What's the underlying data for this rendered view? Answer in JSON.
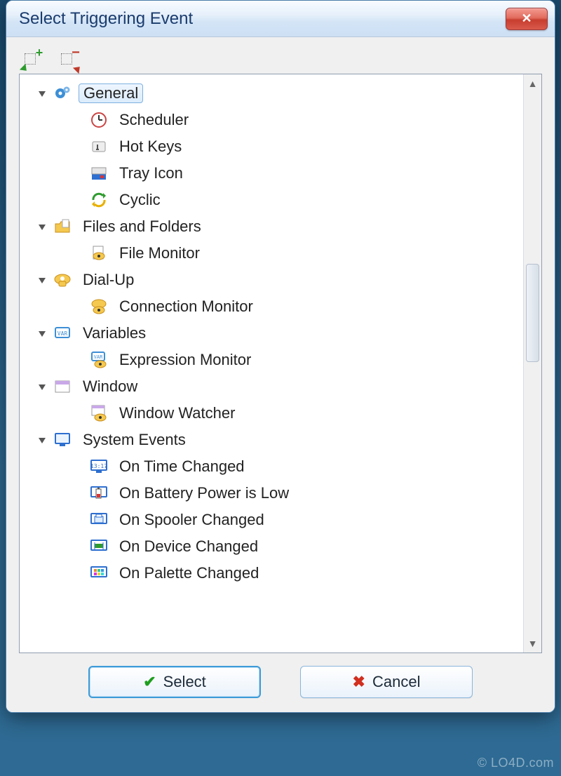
{
  "window": {
    "title": "Select Triggering Event"
  },
  "toolbar": {
    "expand_all": "expand-all",
    "collapse_all": "collapse-all"
  },
  "tree": {
    "selected": "General",
    "groups": [
      {
        "id": "general",
        "label": "General",
        "icon": "gears-icon",
        "expanded": true,
        "selected": true,
        "children": [
          {
            "id": "scheduler",
            "label": "Scheduler",
            "icon": "clock-icon"
          },
          {
            "id": "hotkeys",
            "label": "Hot Keys",
            "icon": "key-icon"
          },
          {
            "id": "trayicon",
            "label": "Tray Icon",
            "icon": "tray-icon"
          },
          {
            "id": "cyclic",
            "label": "Cyclic",
            "icon": "cycle-icon"
          }
        ]
      },
      {
        "id": "files",
        "label": "Files and Folders",
        "icon": "folder-icon",
        "expanded": true,
        "children": [
          {
            "id": "filemon",
            "label": "File Monitor",
            "icon": "eye-file-icon"
          }
        ]
      },
      {
        "id": "dialup",
        "label": "Dial-Up",
        "icon": "phone-icon",
        "expanded": true,
        "children": [
          {
            "id": "connmon",
            "label": "Connection Monitor",
            "icon": "eye-phone-icon"
          }
        ]
      },
      {
        "id": "variables",
        "label": "Variables",
        "icon": "var-icon",
        "expanded": true,
        "children": [
          {
            "id": "exprmon",
            "label": "Expression Monitor",
            "icon": "eye-var-icon"
          }
        ]
      },
      {
        "id": "window",
        "label": "Window",
        "icon": "window-icon",
        "expanded": true,
        "children": [
          {
            "id": "winwatch",
            "label": "Window Watcher",
            "icon": "eye-window-icon"
          }
        ]
      },
      {
        "id": "sysevents",
        "label": "System Events",
        "icon": "monitor-icon",
        "expanded": true,
        "children": [
          {
            "id": "timechg",
            "label": "On Time Changed",
            "icon": "digital-clock-icon"
          },
          {
            "id": "battlow",
            "label": "On Battery Power is Low",
            "icon": "battery-icon"
          },
          {
            "id": "spooler",
            "label": "On Spooler Changed",
            "icon": "printer-icon"
          },
          {
            "id": "device",
            "label": "On Device Changed",
            "icon": "chip-icon"
          },
          {
            "id": "palette",
            "label": "On Palette Changed",
            "icon": "palette-icon"
          }
        ]
      }
    ]
  },
  "buttons": {
    "select": "Select",
    "cancel": "Cancel"
  },
  "watermark": "© LO4D.com"
}
